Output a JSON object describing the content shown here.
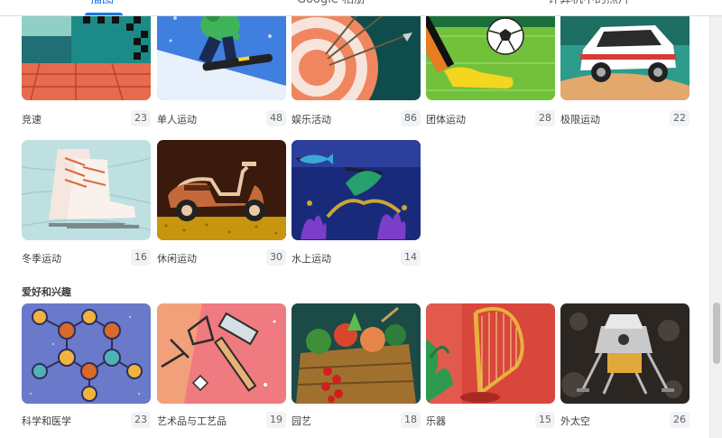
{
  "tabs": [
    {
      "label": "插图",
      "active": true
    },
    {
      "label": "Google 相册",
      "active": false
    },
    {
      "label": "计算机中的照片",
      "active": false
    }
  ],
  "sections": [
    {
      "heading": "",
      "items": [
        {
          "label": "竞速",
          "count": "23",
          "art": "racing-track-icon"
        },
        {
          "label": "单人运动",
          "count": "48",
          "art": "snowboarder-icon"
        },
        {
          "label": "娱乐活动",
          "count": "86",
          "art": "archery-target-icon"
        },
        {
          "label": "团体运动",
          "count": "28",
          "art": "soccer-ball-icon"
        },
        {
          "label": "极限运动",
          "count": "22",
          "art": "rally-car-icon"
        },
        {
          "label": "冬季运动",
          "count": "16",
          "art": "ice-skates-icon"
        },
        {
          "label": "休闲运动",
          "count": "30",
          "art": "scooter-icon"
        },
        {
          "label": "水上运动",
          "count": "14",
          "art": "fish-reef-icon"
        }
      ]
    },
    {
      "heading": "爱好和兴趣",
      "items": [
        {
          "label": "科学和医学",
          "count": "23",
          "art": "molecule-icon"
        },
        {
          "label": "艺术品与工艺品",
          "count": "19",
          "art": "hammer-icon"
        },
        {
          "label": "园艺",
          "count": "18",
          "art": "vegetable-crate-icon"
        },
        {
          "label": "乐器",
          "count": "15",
          "art": "harp-icon"
        },
        {
          "label": "外太空",
          "count": "26",
          "art": "lunar-lander-icon"
        }
      ]
    }
  ],
  "colors": {
    "accent": "#1a73e8",
    "badge_bg": "#f1f3f4",
    "text": "#3c4043"
  }
}
